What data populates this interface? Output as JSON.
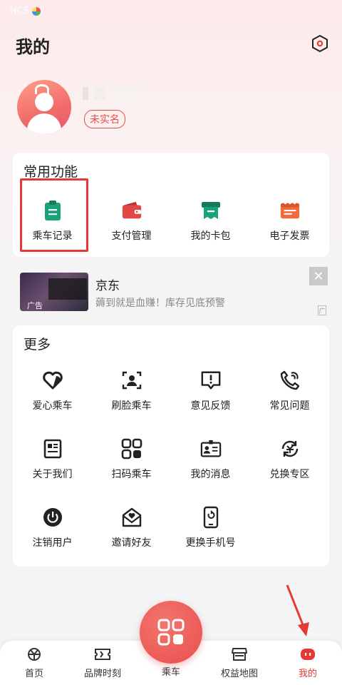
{
  "status_bar": {
    "carrier": "NCS",
    "time": ""
  },
  "page": {
    "title": "我的"
  },
  "user": {
    "name": "",
    "realname_badge": "未实名"
  },
  "common": {
    "title": "常用功能",
    "items": [
      {
        "label": "乘车记录",
        "icon": "clipboard-icon",
        "color": "#1aa37a"
      },
      {
        "label": "支付管理",
        "icon": "wallet-icon",
        "color": "#e04848"
      },
      {
        "label": "我的卡包",
        "icon": "card-holder-icon",
        "color": "#1aa37a"
      },
      {
        "label": "电子发票",
        "icon": "invoice-icon",
        "color": "#f06a3c"
      }
    ]
  },
  "ad": {
    "title": "京东",
    "subtitle": "薅到就是血赚！库存见底预警",
    "badge": "广告",
    "close": "✕",
    "mark": "广"
  },
  "more": {
    "title": "更多",
    "items": [
      {
        "label": "爱心乘车",
        "icon": "heart-ride-icon"
      },
      {
        "label": "刷脸乘车",
        "icon": "face-scan-icon"
      },
      {
        "label": "意见反馈",
        "icon": "feedback-icon"
      },
      {
        "label": "常见问题",
        "icon": "phone-question-icon"
      },
      {
        "label": "关于我们",
        "icon": "about-icon"
      },
      {
        "label": "扫码乘车",
        "icon": "qr-code-icon"
      },
      {
        "label": "我的消息",
        "icon": "message-card-icon"
      },
      {
        "label": "兑换专区",
        "icon": "exchange-icon"
      },
      {
        "label": "注销用户",
        "icon": "power-icon"
      },
      {
        "label": "邀请好友",
        "icon": "invite-icon"
      },
      {
        "label": "更换手机号",
        "icon": "change-phone-icon"
      }
    ]
  },
  "tabs": [
    {
      "label": "首页",
      "icon": "home-icon"
    },
    {
      "label": "品牌时刻",
      "icon": "ticket-icon"
    },
    {
      "label": "乘车",
      "icon": "qr-ride-icon"
    },
    {
      "label": "权益地图",
      "icon": "store-icon"
    },
    {
      "label": "我的",
      "icon": "mine-icon",
      "active": true
    }
  ],
  "colors": {
    "accent": "#e53935",
    "green": "#1aa37a",
    "brand_red": "#e94e4e"
  }
}
